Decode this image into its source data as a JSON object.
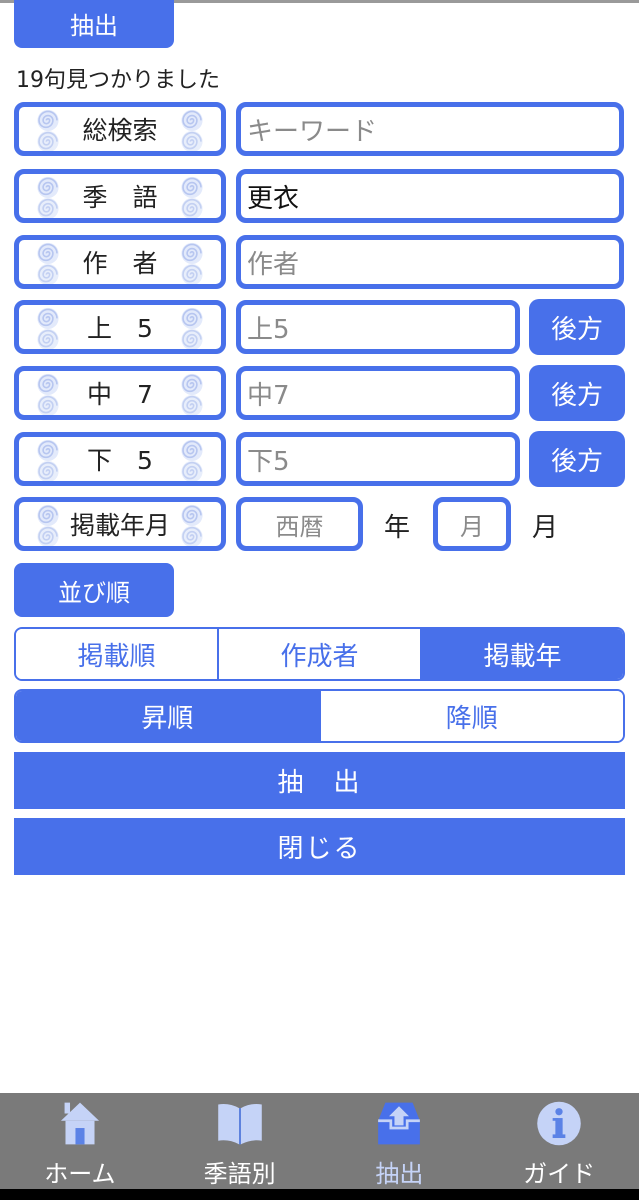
{
  "header": {
    "extract_label": "抽出",
    "result_count": "19句見つかりました"
  },
  "colors": {
    "accent": "#4870ea",
    "tabbar_bg": "#7a7a7a",
    "tab_icon": "#c5d3f7"
  },
  "fields": [
    {
      "label": "総検索",
      "placeholder": "キーワード",
      "value": ""
    },
    {
      "label": "季　語",
      "placeholder": "",
      "value": "更衣"
    },
    {
      "label": "作　者",
      "placeholder": "作者",
      "value": ""
    },
    {
      "label": "上　5",
      "placeholder": "上5",
      "value": "",
      "button": "後方"
    },
    {
      "label": "中　7",
      "placeholder": "中7",
      "value": "",
      "button": "後方"
    },
    {
      "label": "下　5",
      "placeholder": "下5",
      "value": "",
      "button": "後方"
    }
  ],
  "date_field": {
    "label": "掲載年月",
    "year_placeholder": "西暦",
    "year_unit": "年",
    "month_placeholder": "月",
    "month_unit": "月"
  },
  "sort": {
    "header_label": "並び順",
    "order_by": [
      {
        "label": "掲載順",
        "active": false
      },
      {
        "label": "作成者",
        "active": false
      },
      {
        "label": "掲載年",
        "active": true
      }
    ],
    "direction": [
      {
        "label": "昇順",
        "active": true
      },
      {
        "label": "降順",
        "active": false
      }
    ]
  },
  "actions": {
    "extract_label": "抽　出",
    "close_label": "閉じる"
  },
  "tabbar": {
    "items": [
      {
        "label": "ホーム",
        "icon": "home-icon",
        "active": false
      },
      {
        "label": "季語別",
        "icon": "book-icon",
        "active": false
      },
      {
        "label": "抽出",
        "icon": "extract-tray-icon",
        "active": true
      },
      {
        "label": "ガイド",
        "icon": "info-icon",
        "active": false
      }
    ]
  }
}
